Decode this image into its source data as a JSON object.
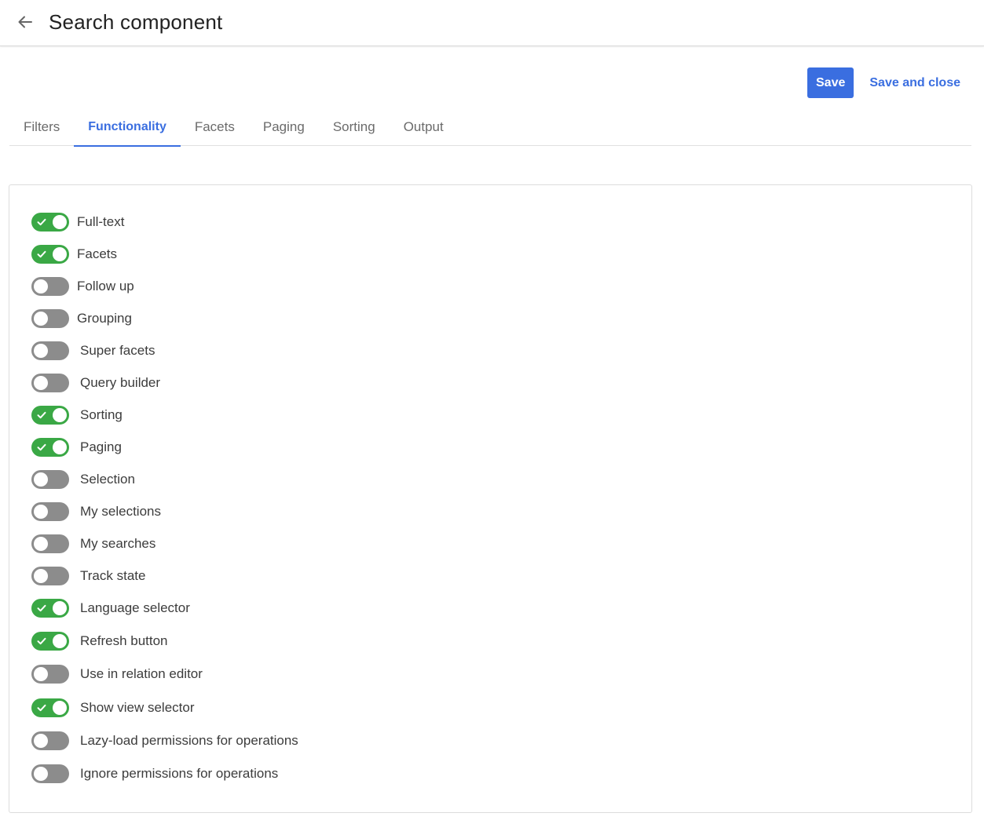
{
  "header": {
    "title": "Search component"
  },
  "actions": {
    "save_label": "Save",
    "save_close_label": "Save and close"
  },
  "tabs": [
    {
      "label": "Filters",
      "active": false
    },
    {
      "label": "Functionality",
      "active": true
    },
    {
      "label": "Facets",
      "active": false
    },
    {
      "label": "Paging",
      "active": false
    },
    {
      "label": "Sorting",
      "active": false
    },
    {
      "label": "Output",
      "active": false
    }
  ],
  "toggles": [
    {
      "label": "Full-text",
      "on": true
    },
    {
      "label": "Facets",
      "on": true
    },
    {
      "label": "Follow up",
      "on": false
    },
    {
      "label": "Grouping",
      "on": false
    },
    {
      "label": "Super facets",
      "on": false
    },
    {
      "label": "Query builder",
      "on": false
    },
    {
      "label": "Sorting",
      "on": true
    },
    {
      "label": "Paging",
      "on": true
    },
    {
      "label": "Selection",
      "on": false
    },
    {
      "label": "My selections",
      "on": false
    },
    {
      "label": "My searches",
      "on": false
    },
    {
      "label": "Track state",
      "on": false
    },
    {
      "label": "Language selector",
      "on": true
    },
    {
      "label": "Refresh button",
      "on": true
    },
    {
      "label": "Use in relation editor",
      "on": false
    },
    {
      "label": "Show view selector",
      "on": true
    },
    {
      "label": "Lazy-load permissions for operations",
      "on": false
    },
    {
      "label": "Ignore permissions for operations",
      "on": false
    }
  ],
  "colors": {
    "accent": "#3a6ee0",
    "toggle_on": "#3aa845",
    "toggle_off": "#8c8c8c"
  },
  "icons": {
    "back": "arrow-left-icon",
    "check": "check-icon"
  }
}
